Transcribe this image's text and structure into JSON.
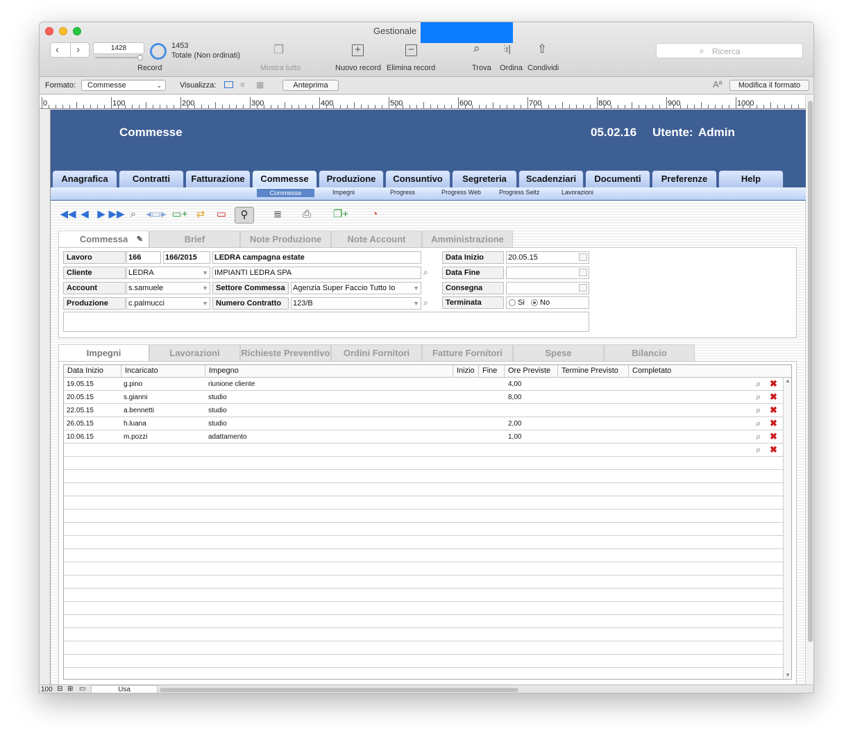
{
  "window": {
    "title": "Gestionale"
  },
  "toolbar": {
    "record_current": "1428",
    "record_total": "1453",
    "record_status": "Totale (Non ordinati)",
    "record_label": "Record",
    "show_all": "Mostra tutto",
    "new_record": "Nuovo record",
    "delete_record": "Elimina record",
    "find": "Trova",
    "sort": "Ordina",
    "share": "Condividi",
    "search_placeholder": "Ricerca"
  },
  "formatbar": {
    "format_label": "Formato:",
    "format_value": "Commesse",
    "view_label": "Visualizza:",
    "preview": "Anteprima",
    "edit_format": "Modifica il formato"
  },
  "ruler": [
    "0",
    "100",
    "200",
    "300",
    "400",
    "500",
    "600",
    "700",
    "800",
    "900",
    "1000"
  ],
  "header": {
    "title": "Commesse",
    "date": "05.02.16",
    "user_label": "Utente:",
    "user": "Admin"
  },
  "nav": {
    "tabs": [
      "Anagrafica",
      "Contratti",
      "Fatturazione",
      "Commesse",
      "Produzione",
      "Consuntivo",
      "Segreteria",
      "Scadenziari",
      "Documenti",
      "Preferenze",
      "Help"
    ],
    "subtabs": [
      "Commesse",
      "Impegni",
      "Progress",
      "Progress Web",
      "Progress Seltz",
      "Lavorazioni"
    ]
  },
  "form": {
    "tabs": [
      "Commessa",
      "Brief",
      "Note Produzione",
      "Note Account",
      "Amministrazione"
    ],
    "labels": {
      "lavoro": "Lavoro",
      "cliente": "Cliente",
      "account": "Account",
      "produzione": "Produzione",
      "settore": "Settore Commessa",
      "contratto": "Numero Contratto",
      "data_inizio": "Data Inizio",
      "data_fine": "Data Fine",
      "consegna": "Consegna",
      "terminata": "Terminata"
    },
    "values": {
      "lavoro_num": "166",
      "lavoro_code": "166/2015",
      "lavoro_name": "LEDRA campagna estate",
      "cliente_code": "LEDRA",
      "cliente_name": "IMPIANTI LEDRA SPA",
      "account": "s.samuele",
      "produzione": "c.palmucci",
      "settore": "Agenzia Super Faccio Tutto Io",
      "contratto": "123/B",
      "data_inizio": "20.05.15",
      "data_fine": "",
      "consegna": "",
      "si": "Si",
      "no": "No"
    }
  },
  "lower": {
    "tabs": [
      "Impegni",
      "Lavorazioni",
      "Richieste Preventivo",
      "Ordini Fornitori",
      "Fatture Fornitori",
      "Spese",
      "Bilancio"
    ],
    "columns": [
      "Data Inizio",
      "Incaricato",
      "Impegno",
      "Inizio",
      "Fine",
      "Ore Previste",
      "Termine Previsto",
      "Completato"
    ],
    "rows": [
      {
        "data": "19.05.15",
        "incaricato": "g.pino",
        "impegno": "riunione cliente",
        "ore": "4,00"
      },
      {
        "data": "20.05.15",
        "incaricato": "s.gianni",
        "impegno": "studio",
        "ore": "8,00"
      },
      {
        "data": "22.05.15",
        "incaricato": "a.bennetti",
        "impegno": "studio",
        "ore": ""
      },
      {
        "data": "26.05.15",
        "incaricato": "h.luana",
        "impegno": "studio",
        "ore": "2,00"
      },
      {
        "data": "10.06.15",
        "incaricato": "m.pozzi",
        "impegno": "adattamento",
        "ore": "1,00"
      }
    ]
  },
  "statusbar": {
    "zoom": "100",
    "mode": "Usa"
  },
  "colors": {
    "header_bg": "#3e5f94",
    "accent": "#2f6fd6",
    "delete_red": "#cc1a1a"
  }
}
